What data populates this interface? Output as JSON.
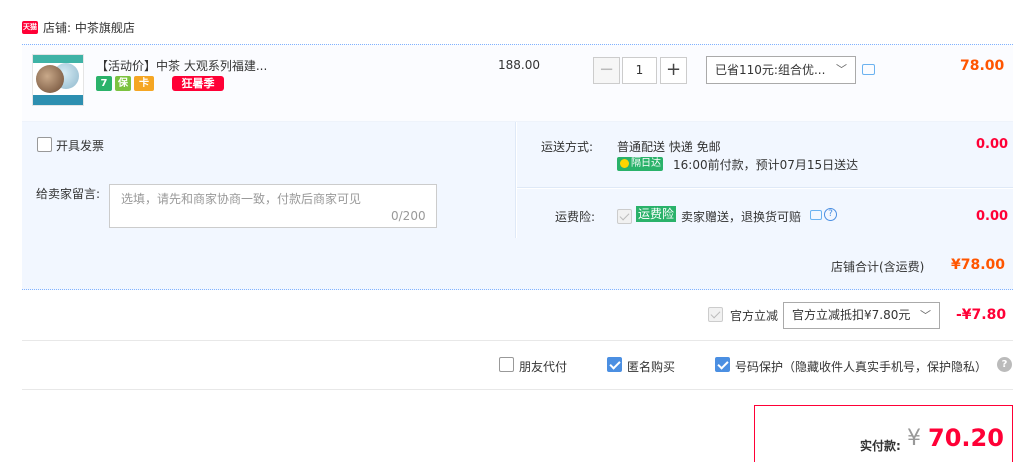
{
  "shop": {
    "badge": "天猫",
    "name": "店铺: 中茶旗舰店"
  },
  "item": {
    "title": "【活动价】中茶 大观系列福建...",
    "service_icons": [
      "7",
      "保",
      "卡"
    ],
    "promo_tag": "狂暑季",
    "unit_price": "188.00",
    "quantity": "1",
    "qty_minus": "−",
    "qty_plus": "+",
    "discount_option": "已省110元:组合优...",
    "total": "78.00"
  },
  "invoice": {
    "label": "开具发票",
    "checked": false
  },
  "message": {
    "label": "给卖家留言:",
    "placeholder": "选填，请先和商家协商一致，付款后商家可见",
    "count": "0/200"
  },
  "shipping": {
    "label": "运送方式:",
    "method": "普通配送 快递 免邮",
    "badge": "隔日达",
    "eta": "16:00前付款，预计07月15日送达",
    "fee": "0.00"
  },
  "insurance": {
    "label": "运费险:",
    "badge": "运费险",
    "text": "卖家赠送，退换货可赔",
    "fee": "0.00"
  },
  "shop_total": {
    "label": "店铺合计(含运费)",
    "value": "¥78.00"
  },
  "official_discount": {
    "label": "官方立减",
    "option": "官方立减抵扣¥7.80元",
    "value": "-¥7.80"
  },
  "options": {
    "friend_pay": {
      "label": "朋友代付",
      "checked": false
    },
    "anonymous": {
      "label": "匿名购买",
      "checked": true
    },
    "phone_protect": {
      "label": "号码保护（隐藏收件人真实手机号，保护隐私）",
      "checked": true
    }
  },
  "payment": {
    "label": "实付款:",
    "currency": "¥",
    "amount": "70.20"
  },
  "colors": {
    "accent_red": "#ff0036",
    "price_orange": "#ff5500",
    "panel_blue": "#f2f7ff",
    "checkbox_blue": "#4b8fe2",
    "green_badge": "#2ab26a"
  }
}
